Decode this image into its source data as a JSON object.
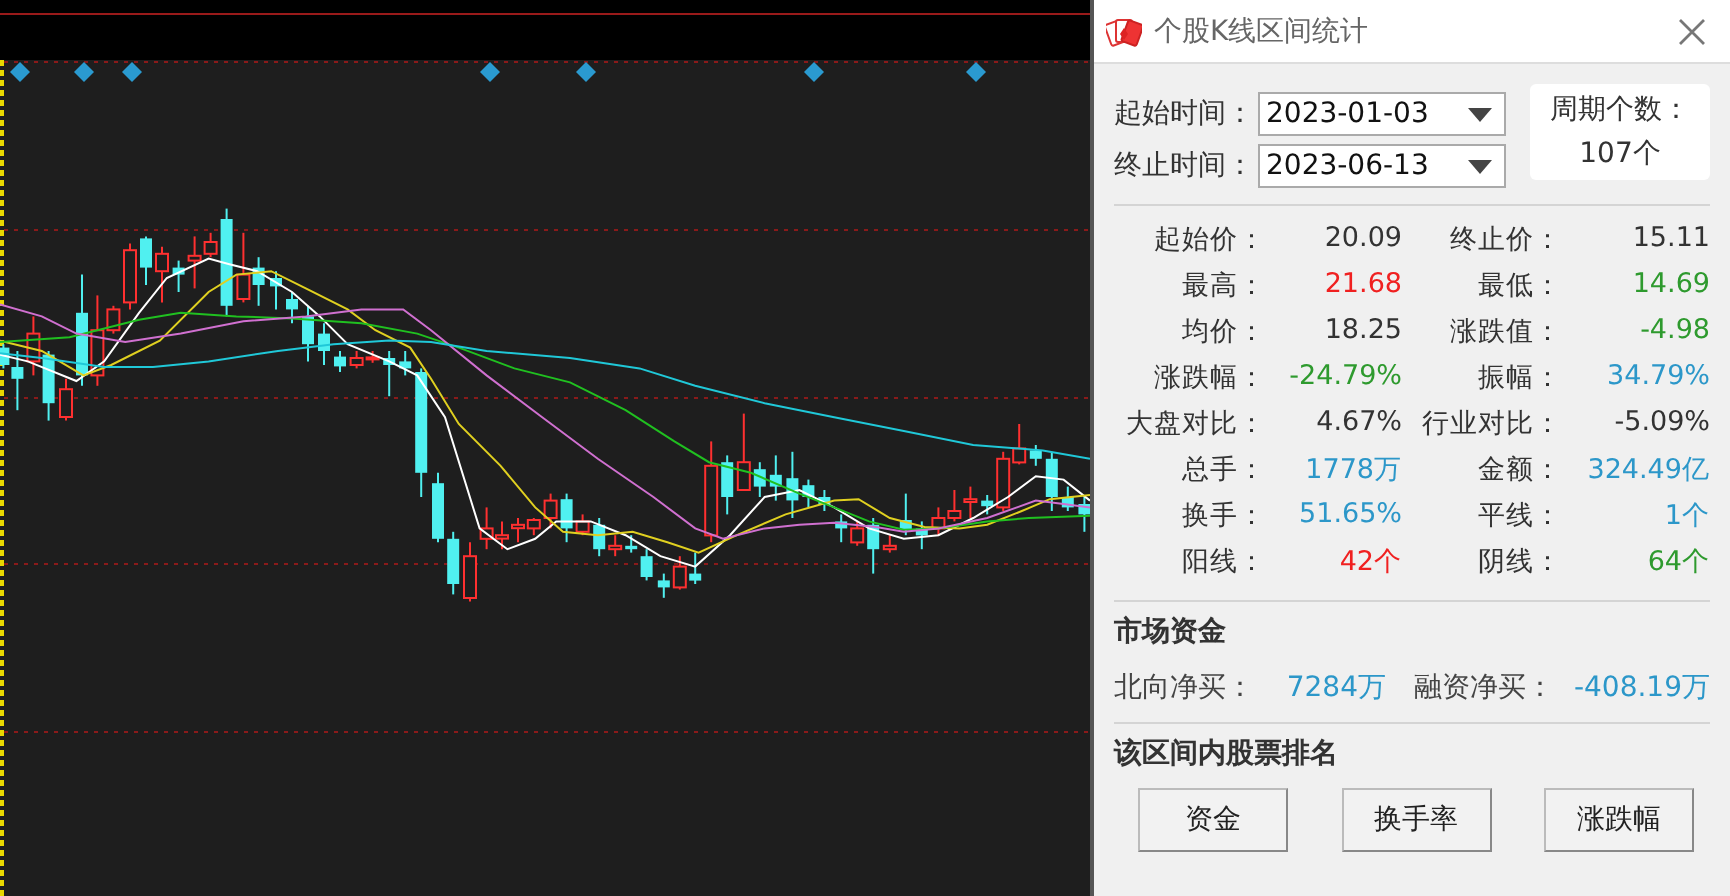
{
  "window": {
    "title": "个股K线区间统计"
  },
  "range": [
    {
      "label": "起始时间：",
      "value": "2023-01-03"
    },
    {
      "label": "终止时间：",
      "value": "2023-06-13"
    }
  ],
  "period": {
    "label": "周期个数：",
    "value": "107个"
  },
  "stats": [
    {
      "cells": [
        {
          "label": "起始价：",
          "value": "20.09",
          "color": "#333333"
        },
        {
          "label": "终止价：",
          "value": "15.11",
          "color": "#333333"
        }
      ]
    },
    {
      "cells": [
        {
          "label": "最高：",
          "value": "21.68",
          "color": "#f02020"
        },
        {
          "label": "最低：",
          "value": "14.69",
          "color": "#2e9a2e"
        }
      ]
    },
    {
      "cells": [
        {
          "label": "均价：",
          "value": "18.25",
          "color": "#333333"
        },
        {
          "label": "涨跌值：",
          "value": "-4.98",
          "color": "#2e9a2e"
        }
      ]
    },
    {
      "cells": [
        {
          "label": "涨跌幅：",
          "value": "-24.79%",
          "color": "#2e9a2e"
        },
        {
          "label": "振幅：",
          "value": "34.79%",
          "color": "#2c97c9"
        }
      ]
    },
    {
      "cells": [
        {
          "label": "大盘对比：",
          "value": "4.67%",
          "color": "#333333"
        },
        {
          "label": "行业对比：",
          "value": "-5.09%",
          "color": "#333333"
        }
      ]
    },
    {
      "cells": [
        {
          "label": "总手：",
          "value": "1778万",
          "color": "#2c97c9"
        },
        {
          "label": "金额：",
          "value": "324.49亿",
          "color": "#2c97c9"
        }
      ]
    },
    {
      "cells": [
        {
          "label": "换手：",
          "value": "51.65%",
          "color": "#2c97c9"
        },
        {
          "label": "平线：",
          "value": "1个",
          "color": "#2c97c9"
        }
      ]
    },
    {
      "cells": [
        {
          "label": "阳线：",
          "value": "42个",
          "color": "#f02020"
        },
        {
          "label": "阴线：",
          "value": "64个",
          "color": "#2e9a2e"
        }
      ]
    }
  ],
  "market_funds": {
    "title": "市场资金",
    "items": [
      {
        "label": "北向净买：",
        "value": "7284万"
      },
      {
        "label": "融资净买：",
        "value": "-408.19万"
      }
    ]
  },
  "ranking": {
    "title": "该区间内股票排名",
    "buttons": [
      "资金",
      "换手率",
      "涨跌幅"
    ]
  }
}
